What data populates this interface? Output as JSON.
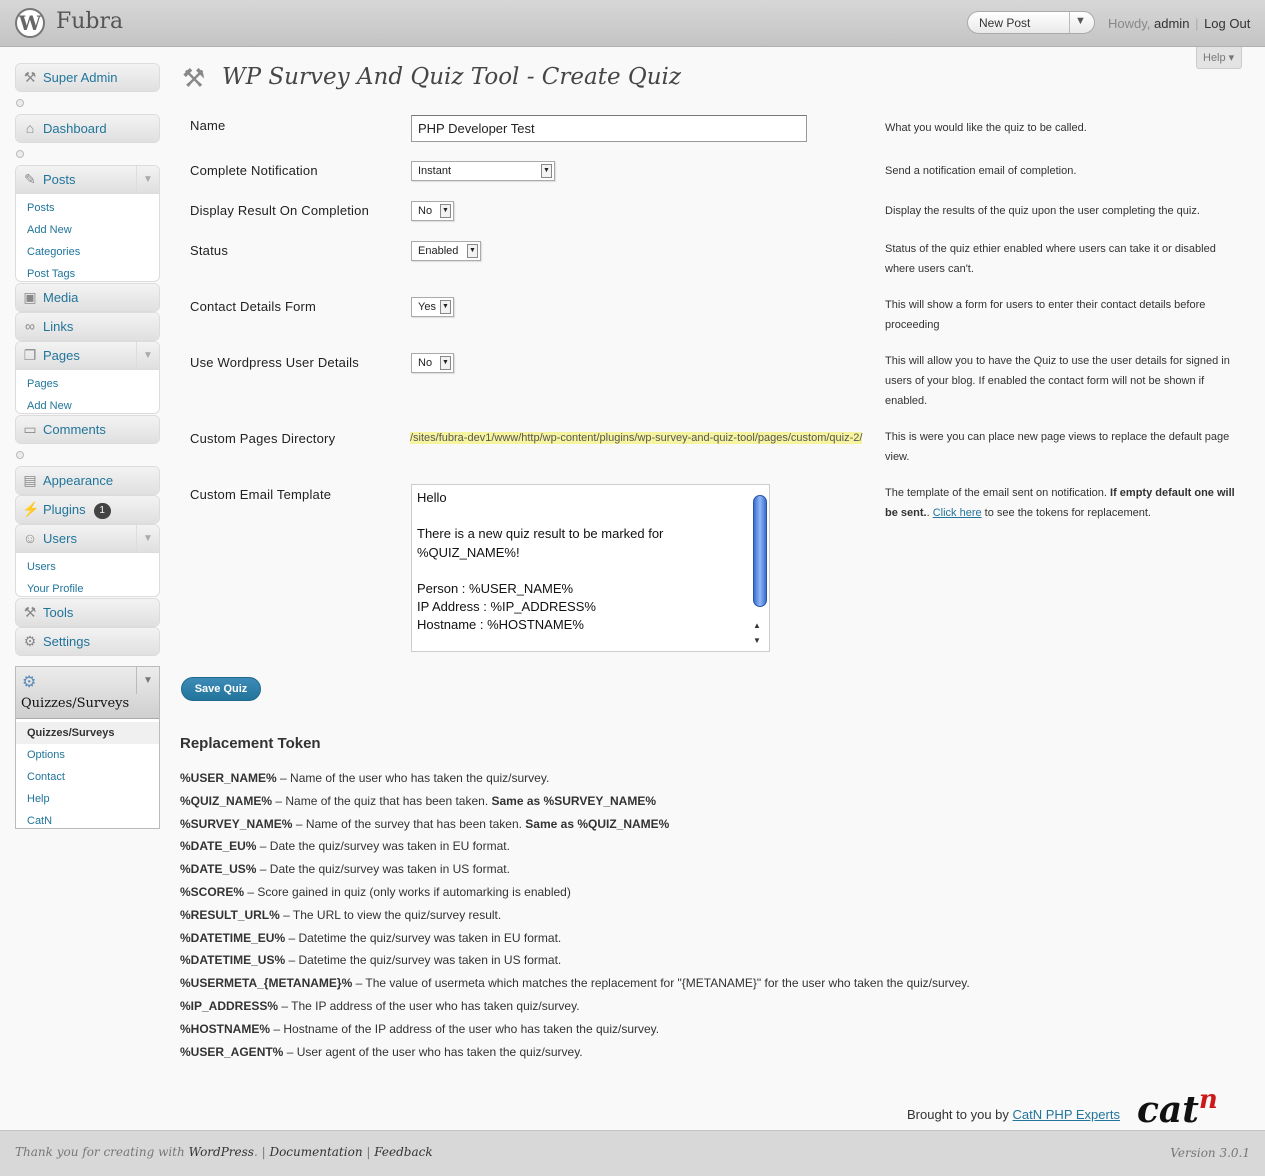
{
  "header": {
    "site_title": "Fubra",
    "wp_logo_letter": "W",
    "favorite_action": "New Post",
    "howdy": "Howdy,",
    "username": "admin",
    "logout": "Log Out",
    "help": "Help ▾"
  },
  "sidebar": {
    "super_admin": "Super Admin",
    "dashboard": "Dashboard",
    "posts": {
      "label": "Posts",
      "items": [
        "Posts",
        "Add New",
        "Categories",
        "Post Tags"
      ]
    },
    "media": "Media",
    "links": "Links",
    "pages": {
      "label": "Pages",
      "items": [
        "Pages",
        "Add New"
      ]
    },
    "comments": "Comments",
    "appearance": "Appearance",
    "plugins": "Plugins",
    "plugins_badge": "1",
    "users": {
      "label": "Users",
      "items": [
        "Users",
        "Your Profile"
      ]
    },
    "tools": "Tools",
    "settings": "Settings",
    "quizzes": {
      "label": "Quizzes/Surveys",
      "items": [
        "Quizzes/Surveys",
        "Options",
        "Contact",
        "Help",
        "CatN"
      ]
    }
  },
  "page": {
    "title": "WP Survey And Quiz Tool - Create Quiz"
  },
  "form": {
    "name": {
      "label": "Name",
      "value": "PHP Developer Test",
      "desc": "What you would like the quiz to be called."
    },
    "complete_notification": {
      "label": "Complete Notification",
      "value": "Instant",
      "desc": "Send a notification email of completion."
    },
    "display_result": {
      "label": "Display Result On Completion",
      "value": "No",
      "desc": "Display the results of the quiz upon the user completing the quiz."
    },
    "status": {
      "label": "Status",
      "value": "Enabled",
      "desc": "Status of the quiz ethier enabled where users can take it or disabled where users can't."
    },
    "contact_form": {
      "label": "Contact Details Form",
      "value": "Yes",
      "desc": "This will show a form for users to enter their contact details before proceeding"
    },
    "use_wp_user": {
      "label": "Use Wordpress User Details",
      "value": "No",
      "desc": "This will allow you to have the Quiz to use the user details for signed in users of your blog. If enabled the contact form will not be shown if enabled."
    },
    "pages_dir": {
      "label": "Custom Pages Directory",
      "value": "/sites/fubra-dev1/www/http/wp-content/plugins/wp-survey-and-quiz-tool/pages/custom/quiz-2/",
      "desc": "This is were you can place new page views to replace the default page view."
    },
    "email_template": {
      "label": "Custom Email Template",
      "value": "Hello\n\nThere is a new quiz result to be marked for %QUIZ_NAME%!\n\nPerson : %USER_NAME%\nIP Address : %IP_ADDRESS%\nHostname : %HOSTNAME%",
      "desc_plain": "The template of the email sent on notification.",
      "desc_bold": "If empty default one will be sent.",
      "desc_dot": ".",
      "desc_link": "Click here",
      "desc_after": "to see the tokens for replacement."
    },
    "save": "Save Quiz"
  },
  "tokens": {
    "heading": "Replacement Token",
    "items": [
      {
        "token": "%USER_NAME%",
        "desc": " – Name of the user who has taken the quiz/survey.",
        "note": ""
      },
      {
        "token": "%QUIZ_NAME%",
        "desc": " – Name of the quiz that has been taken. ",
        "note": "Same as %SURVEY_NAME%"
      },
      {
        "token": "%SURVEY_NAME%",
        "desc": " – Name of the survey that has been taken. ",
        "note": "Same as %QUIZ_NAME%"
      },
      {
        "token": "%DATE_EU%",
        "desc": " – Date the quiz/survey was taken in EU format.",
        "note": ""
      },
      {
        "token": "%DATE_US%",
        "desc": " – Date the quiz/survey was taken in US format.",
        "note": ""
      },
      {
        "token": "%SCORE%",
        "desc": " – Score gained in quiz (only works if automarking is enabled)",
        "note": ""
      },
      {
        "token": "%RESULT_URL%",
        "desc": " – The URL to view the quiz/survey result.",
        "note": ""
      },
      {
        "token": "%DATETIME_EU%",
        "desc": " – Datetime the quiz/survey was taken in EU format.",
        "note": ""
      },
      {
        "token": "%DATETIME_US%",
        "desc": " – Datetime the quiz/survey was taken in US format.",
        "note": ""
      },
      {
        "token": "%USERMETA_{METANAME}%",
        "desc": " – The value of usermeta which matches the replacement for \"{METANAME}\" for the user who taken the quiz/survey.",
        "note": ""
      },
      {
        "token": "%IP_ADDRESS%",
        "desc": " – The IP address of the user who has taken quiz/survey.",
        "note": ""
      },
      {
        "token": "%HOSTNAME%",
        "desc": " – Hostname of the IP address of the user who has taken the quiz/survey.",
        "note": ""
      },
      {
        "token": "%USER_AGENT%",
        "desc": " – User agent of the user who has taken the quiz/survey.",
        "note": ""
      }
    ]
  },
  "credits": {
    "text": "Brought to you by",
    "link": "CatN PHP Experts",
    "logo_text": "cat",
    "logo_sup": "n"
  },
  "footer": {
    "thanks": "Thank you for creating with",
    "wordpress": "WordPress",
    "documentation": "Documentation",
    "feedback": "Feedback",
    "version": "Version 3.0.1"
  }
}
